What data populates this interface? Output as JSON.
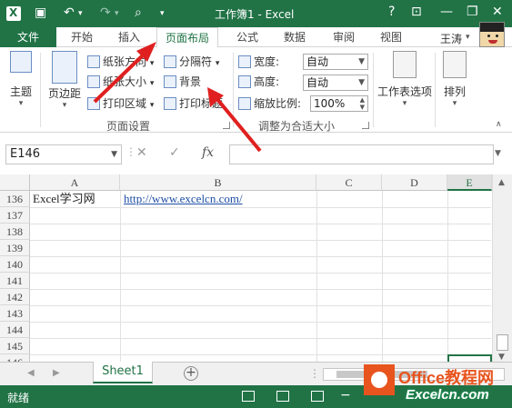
{
  "titlebar": {
    "title": "工作簿1 - Excel",
    "logo": "X",
    "help": "?",
    "minimize": "—",
    "close": "✕"
  },
  "tabs": {
    "file": "文件",
    "items": [
      "开始",
      "插入",
      "页面布局",
      "公式",
      "数据",
      "审阅",
      "视图"
    ],
    "active": "页面布局",
    "user": "王涛"
  },
  "ribbon": {
    "themes": "主题",
    "margins": "页边距",
    "orientation": "纸张方向",
    "size": "纸张大小",
    "print_area": "打印区域",
    "breaks": "分隔符",
    "background": "背景",
    "print_titles": "打印标题",
    "group_page_setup": "页面设置",
    "width_label": "宽度:",
    "height_label": "高度:",
    "scale_label": "缩放比例:",
    "width_value": "自动",
    "height_value": "自动",
    "scale_value": "100%",
    "group_scale": "调整为合适大小",
    "sheet_options": "工作表选项",
    "arrange": "排列"
  },
  "formula_bar": {
    "name_box": "E146",
    "cancel": "✕",
    "enter": "✓",
    "fx": "fx",
    "formula": ""
  },
  "grid": {
    "columns": [
      "A",
      "B",
      "C",
      "D",
      "E"
    ],
    "selected_column": "E",
    "rows": [
      "136",
      "137",
      "138",
      "139",
      "140",
      "141",
      "142",
      "143",
      "144",
      "145",
      "146"
    ],
    "cells": {
      "A136": "Excel学习网",
      "B136": "http://www.excelcn.com/"
    }
  },
  "sheets": {
    "tabs": [
      "Sheet1"
    ],
    "add": "+"
  },
  "status": {
    "ready": "就绪"
  },
  "watermark": {
    "line1": "Office教程网",
    "line2": "Excelcn.com"
  },
  "colors": {
    "accent": "#217346",
    "arrow": "#e02020",
    "link": "#1e4ea5"
  }
}
